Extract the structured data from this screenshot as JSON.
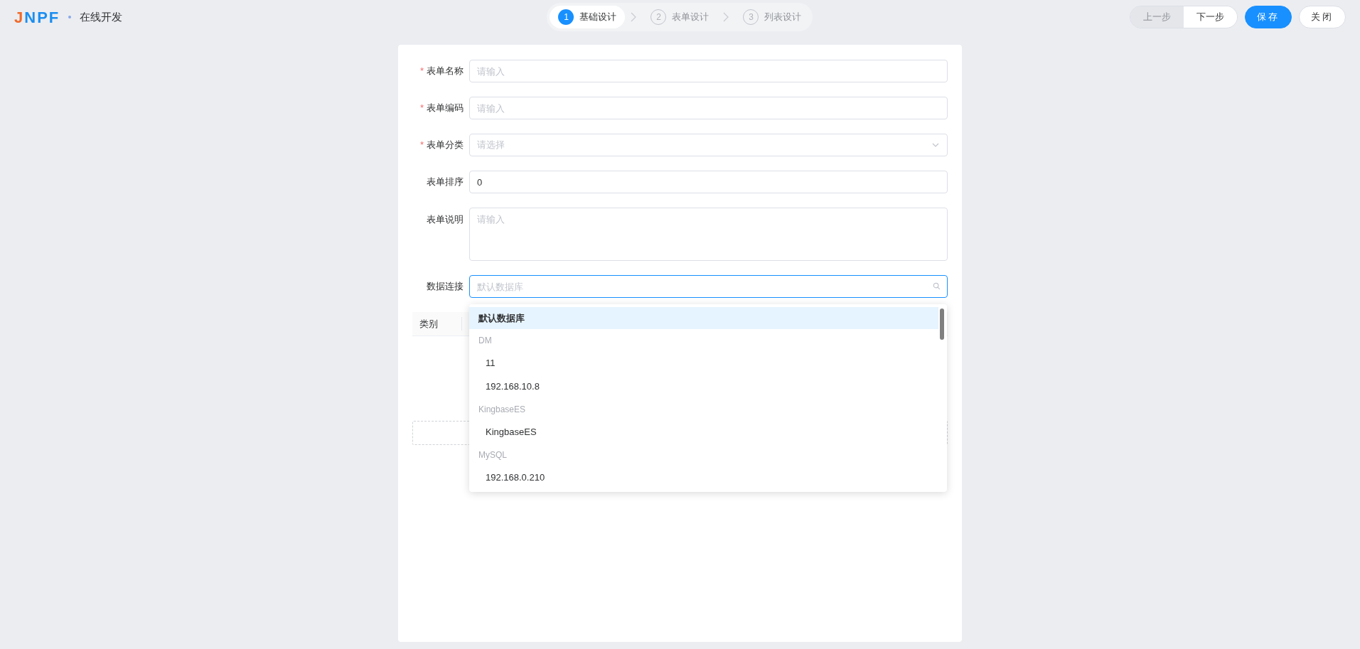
{
  "header": {
    "logo": "JNPF",
    "title": "在线开发"
  },
  "steps": [
    {
      "number": "1",
      "label": "基础设计",
      "selected": true
    },
    {
      "number": "2",
      "label": "表单设计",
      "selected": false
    },
    {
      "number": "3",
      "label": "列表设计",
      "selected": false
    }
  ],
  "actions": [
    {
      "label": "上一步",
      "kind": "plain",
      "disabled": true
    },
    {
      "label": "下一步",
      "kind": "plain",
      "disabled": false
    },
    {
      "label": "保存",
      "kind": "primary",
      "disabled": false
    },
    {
      "label": "关闭",
      "kind": "plain",
      "disabled": false
    }
  ],
  "form": [
    {
      "label": "表单名称",
      "required_mark": "*",
      "kind": "input",
      "placeholder": "请输入"
    },
    {
      "label": "表单编码",
      "required_mark": "*",
      "kind": "input",
      "placeholder": "请输入"
    },
    {
      "label": "表单分类",
      "required_mark": "*",
      "kind": "select",
      "placeholder": "请选择"
    },
    {
      "label": "表单排序",
      "kind": "input",
      "value": "0"
    },
    {
      "label": "表单说明",
      "kind": "textarea",
      "placeholder": "请输入"
    },
    {
      "label": "数据连接",
      "kind": "search",
      "placeholder": "默认数据库"
    }
  ],
  "table": {
    "columns": [
      "类别"
    ]
  },
  "dropdown": [
    {
      "kind": "group",
      "label": "默认数据库",
      "selected": true
    },
    {
      "kind": "group",
      "label": "DM",
      "selected": false
    },
    {
      "kind": "option",
      "label": "11",
      "selected": false
    },
    {
      "kind": "option",
      "label": "192.168.10.8",
      "selected": false
    },
    {
      "kind": "group",
      "label": "KingbaseES",
      "selected": false
    },
    {
      "kind": "option",
      "label": "KingbaseES",
      "selected": false
    },
    {
      "kind": "group",
      "label": "MySQL",
      "selected": false
    },
    {
      "kind": "option",
      "label": "192.168.0.210",
      "selected": false
    }
  ]
}
